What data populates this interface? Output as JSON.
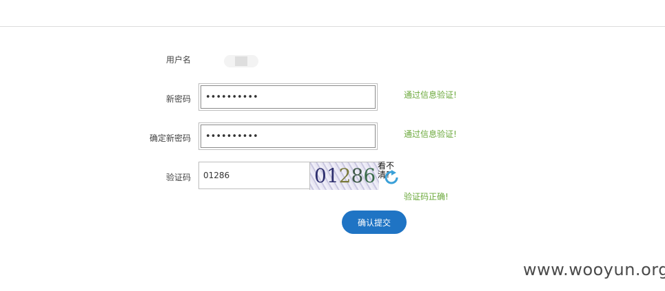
{
  "form": {
    "username": {
      "label": "用户名"
    },
    "new_password": {
      "label": "新密码",
      "value": "••••••••••",
      "message": "通过信息验证!"
    },
    "confirm_password": {
      "label": "确定新密码",
      "value": "••••••••••",
      "message": "通过信息验证!"
    },
    "captcha": {
      "label": "验证码",
      "value": "01286",
      "image_text": [
        "0",
        "1",
        "2",
        "8",
        "6"
      ],
      "refresh_label": "看不清?",
      "message": "验证码正确!"
    },
    "submit_label": "确认提交"
  },
  "watermark": "www.wooyun.org",
  "colors": {
    "success": "#6aa83a",
    "primary": "#1f74c4"
  }
}
